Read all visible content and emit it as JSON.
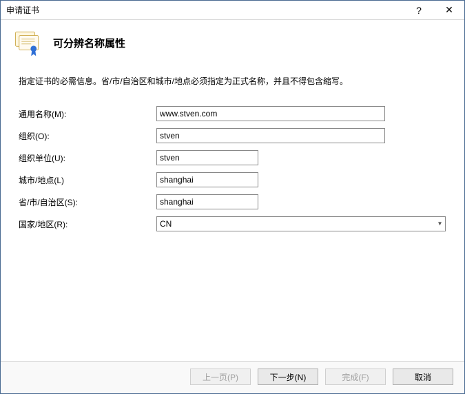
{
  "window": {
    "title": "申请证书"
  },
  "header": {
    "heading": "可分辨名称属性"
  },
  "instruction": "指定证书的必需信息。省/市/自治区和城市/地点必须指定为正式名称，并且不得包含缩写。",
  "fields": {
    "common_name": {
      "label": "通用名称(M):",
      "value": "www.stven.com"
    },
    "organization": {
      "label": "组织(O):",
      "value": "stven"
    },
    "org_unit": {
      "label": "组织单位(U):",
      "value": "stven"
    },
    "city": {
      "label": "城市/地点(L)",
      "value": "shanghai"
    },
    "state": {
      "label": "省/市/自治区(S):",
      "value": "shanghai"
    },
    "country": {
      "label": "国家/地区(R):",
      "value": "CN"
    }
  },
  "buttons": {
    "previous": "上一页(P)",
    "next": "下一步(N)",
    "finish": "完成(F)",
    "cancel": "取消"
  },
  "titlebar_icons": {
    "help": "?",
    "close": "✕"
  }
}
